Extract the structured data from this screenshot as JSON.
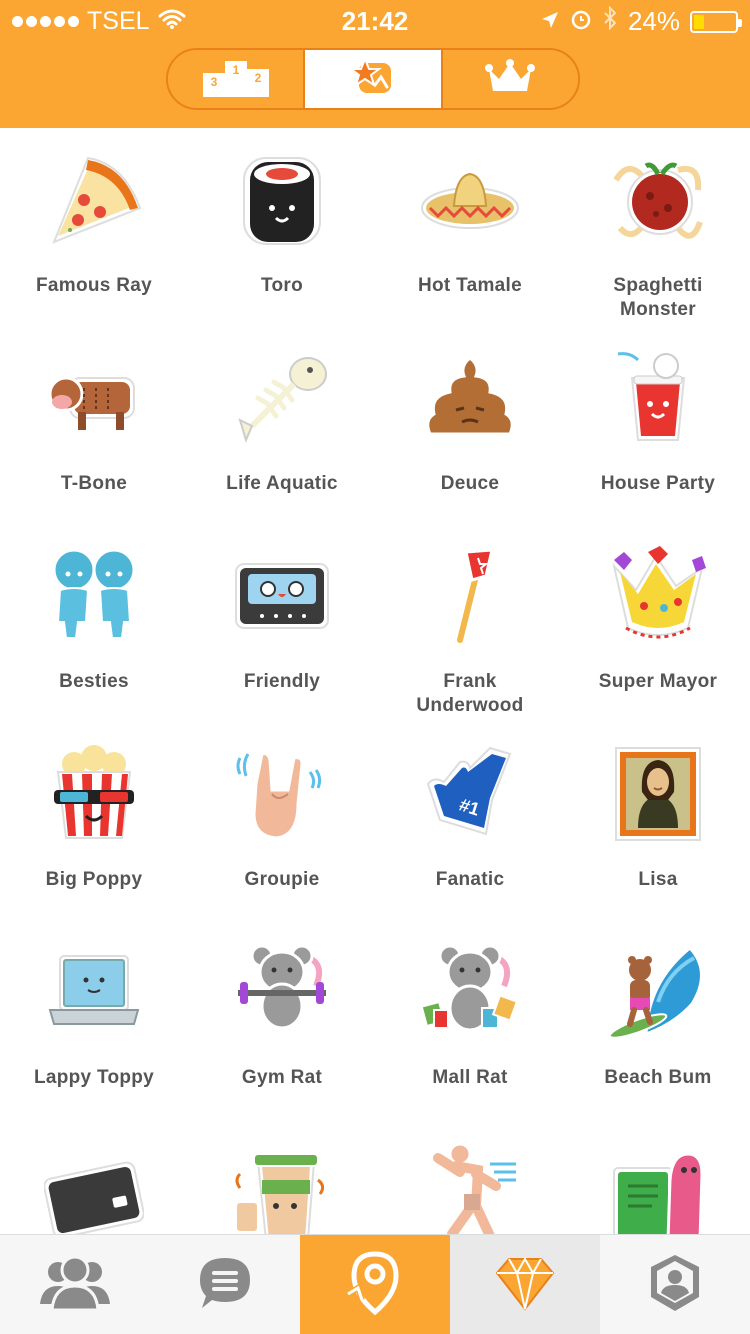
{
  "status_bar": {
    "carrier": "TSEL",
    "time": "21:42",
    "battery": "24%",
    "signal_dots": 5
  },
  "segmented": {
    "tabs": [
      {
        "icon": "leaderboard-podium-icon",
        "podium_numbers": [
          "1",
          "2",
          "3"
        ]
      },
      {
        "icon": "stickers-badge-icon"
      },
      {
        "icon": "crown-icon"
      }
    ],
    "active_index": 1
  },
  "badges": [
    {
      "label": "Famous Ray",
      "icon": "pizza-slice-icon"
    },
    {
      "label": "Toro",
      "icon": "sushi-roll-icon"
    },
    {
      "label": "Hot Tamale",
      "icon": "sombrero-icon"
    },
    {
      "label": "Spaghetti\nMonster",
      "icon": "meatball-icon"
    },
    {
      "label": "T-Bone",
      "icon": "cow-icon"
    },
    {
      "label": "Life Aquatic",
      "icon": "fish-bone-icon"
    },
    {
      "label": "Deuce",
      "icon": "poop-icon"
    },
    {
      "label": "House Party",
      "icon": "red-cup-icon"
    },
    {
      "label": "Besties",
      "icon": "twins-icon"
    },
    {
      "label": "Friendly",
      "icon": "cassette-tape-icon"
    },
    {
      "label": "Frank\nUnderwood",
      "icon": "flag-torch-icon"
    },
    {
      "label": "Super Mayor",
      "icon": "jeweled-crown-icon"
    },
    {
      "label": "Big Poppy",
      "icon": "popcorn-icon"
    },
    {
      "label": "Groupie",
      "icon": "rock-hand-icon"
    },
    {
      "label": "Fanatic",
      "icon": "foam-finger-icon"
    },
    {
      "label": "Lisa",
      "icon": "mona-lisa-icon"
    },
    {
      "label": "Lappy Toppy",
      "icon": "laptop-icon"
    },
    {
      "label": "Gym Rat",
      "icon": "rat-barbell-icon"
    },
    {
      "label": "Mall Rat",
      "icon": "rat-shopping-icon"
    },
    {
      "label": "Beach Bum",
      "icon": "surfing-bear-icon"
    },
    {
      "label": "",
      "icon": "credit-card-icon"
    },
    {
      "label": "",
      "icon": "coffee-cup-icon"
    },
    {
      "label": "",
      "icon": "streaker-icon"
    },
    {
      "label": "",
      "icon": "book-worm-icon"
    }
  ],
  "tab_bar": [
    {
      "icon": "friends-icon"
    },
    {
      "icon": "messages-icon"
    },
    {
      "icon": "check-in-icon"
    },
    {
      "icon": "diamond-icon"
    },
    {
      "icon": "profile-icon"
    }
  ],
  "colors": {
    "brand_orange": "#fba632",
    "label_gray": "#555555",
    "tab_gray": "#8a8a8a"
  }
}
